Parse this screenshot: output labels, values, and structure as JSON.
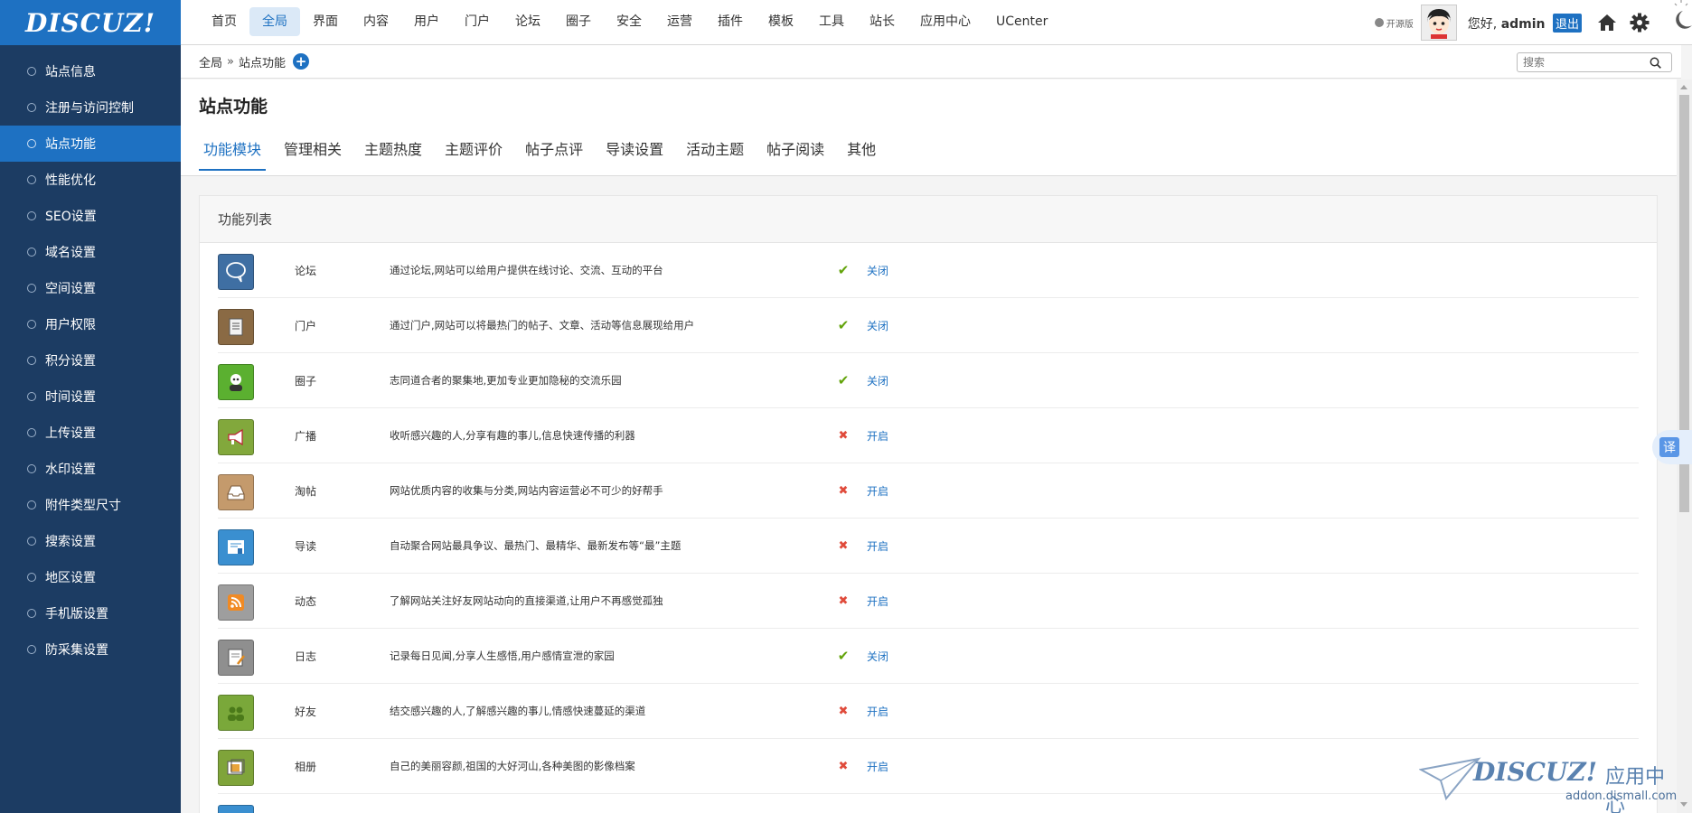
{
  "brand": {
    "logo_text": "DISCUZ!"
  },
  "topnav": {
    "items": [
      {
        "label": "首页",
        "active": false
      },
      {
        "label": "全局",
        "active": true
      },
      {
        "label": "界面",
        "active": false
      },
      {
        "label": "内容",
        "active": false
      },
      {
        "label": "用户",
        "active": false
      },
      {
        "label": "门户",
        "active": false
      },
      {
        "label": "论坛",
        "active": false
      },
      {
        "label": "圈子",
        "active": false
      },
      {
        "label": "安全",
        "active": false
      },
      {
        "label": "运营",
        "active": false
      },
      {
        "label": "插件",
        "active": false
      },
      {
        "label": "模板",
        "active": false
      },
      {
        "label": "工具",
        "active": false
      },
      {
        "label": "站长",
        "active": false
      },
      {
        "label": "应用中心",
        "active": false
      },
      {
        "label": "UCenter",
        "active": false
      }
    ]
  },
  "topright": {
    "skin_label": "开源版",
    "greeting_prefix": "您好,",
    "username": "admin",
    "logout_label": "退出"
  },
  "sidebar": {
    "items": [
      {
        "label": "站点信息",
        "active": false
      },
      {
        "label": "注册与访问控制",
        "active": false
      },
      {
        "label": "站点功能",
        "active": true
      },
      {
        "label": "性能优化",
        "active": false
      },
      {
        "label": "SEO设置",
        "active": false
      },
      {
        "label": "域名设置",
        "active": false
      },
      {
        "label": "空间设置",
        "active": false
      },
      {
        "label": "用户权限",
        "active": false
      },
      {
        "label": "积分设置",
        "active": false
      },
      {
        "label": "时间设置",
        "active": false
      },
      {
        "label": "上传设置",
        "active": false
      },
      {
        "label": "水印设置",
        "active": false
      },
      {
        "label": "附件类型尺寸",
        "active": false
      },
      {
        "label": "搜索设置",
        "active": false
      },
      {
        "label": "地区设置",
        "active": false
      },
      {
        "label": "手机版设置",
        "active": false
      },
      {
        "label": "防采集设置",
        "active": false
      }
    ]
  },
  "breadcrumb": {
    "root": "全局",
    "separator": "»",
    "current": "站点功能",
    "add_label": "+"
  },
  "search": {
    "placeholder": "搜索"
  },
  "page": {
    "title": "站点功能",
    "tabs": [
      {
        "label": "功能模块",
        "active": true
      },
      {
        "label": "管理相关",
        "active": false
      },
      {
        "label": "主题热度",
        "active": false
      },
      {
        "label": "主题评价",
        "active": false
      },
      {
        "label": "帖子点评",
        "active": false
      },
      {
        "label": "导读设置",
        "active": false
      },
      {
        "label": "活动主题",
        "active": false
      },
      {
        "label": "帖子阅读",
        "active": false
      },
      {
        "label": "其他",
        "active": false
      }
    ]
  },
  "panel": {
    "title": "功能列表",
    "features": [
      {
        "name": "论坛",
        "desc": "通过论坛,网站可以给用户提供在线讨论、交流、互动的平台",
        "enabled": true,
        "action": "关闭",
        "icon": "forum-icon",
        "color": "#3f6fa3"
      },
      {
        "name": "门户",
        "desc": "通过门户,网站可以将最热门的帖子、文章、活动等信息展现给用户",
        "enabled": true,
        "action": "关闭",
        "icon": "portal-icon",
        "color": "#8a6a44"
      },
      {
        "name": "圈子",
        "desc": "志同道合者的聚集地,更加专业更加隐秘的交流乐园",
        "enabled": true,
        "action": "关闭",
        "icon": "group-icon",
        "color": "#5bb030"
      },
      {
        "name": "广播",
        "desc": "收听感兴趣的人,分享有趣的事儿,信息快速传播的利器",
        "enabled": false,
        "action": "开启",
        "icon": "broadcast-icon",
        "color": "#82a83c"
      },
      {
        "name": "淘帖",
        "desc": "网站优质内容的收集与分类,网站内容运营必不可少的好帮手",
        "enabled": false,
        "action": "开启",
        "icon": "collection-icon",
        "color": "#c49a6c"
      },
      {
        "name": "导读",
        "desc": "自动聚合网站最具争议、最热门、最精华、最新发布等“最”主题",
        "enabled": false,
        "action": "开启",
        "icon": "guide-icon",
        "color": "#3a8fd0"
      },
      {
        "name": "动态",
        "desc": "了解网站关注好友网站动向的直接渠道,让用户不再感觉孤独",
        "enabled": false,
        "action": "开启",
        "icon": "feed-icon",
        "color": "#9e9e9e"
      },
      {
        "name": "日志",
        "desc": "记录每日见闻,分享人生感悟,用户感情宣泄的家园",
        "enabled": true,
        "action": "关闭",
        "icon": "blog-icon",
        "color": "#8f8f8f"
      },
      {
        "name": "好友",
        "desc": "结交感兴趣的人,了解感兴趣的事儿,情感快速蔓延的渠道",
        "enabled": false,
        "action": "开启",
        "icon": "friend-icon",
        "color": "#7aa83a"
      },
      {
        "name": "相册",
        "desc": "自己的美丽容颜,祖国的大好河山,各种美图的影像档案",
        "enabled": false,
        "action": "开启",
        "icon": "album-icon",
        "color": "#7fa43a"
      },
      {
        "name": "",
        "desc": "",
        "enabled": false,
        "action": "",
        "icon": "",
        "color": "#3a8fd0"
      }
    ]
  },
  "translate": {
    "label": "译"
  },
  "watermark": {
    "brand": "DISCUZ!",
    "cn": "应用中心",
    "url": "addon.dismall.com"
  }
}
